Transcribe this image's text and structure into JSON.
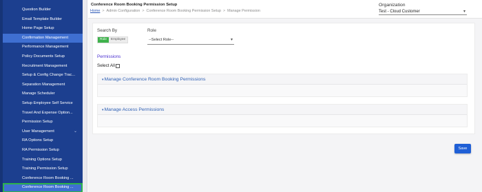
{
  "sidebar": {
    "items": [
      {
        "label": "Question Builder",
        "state": "normal"
      },
      {
        "label": "Email Template Builder",
        "state": "normal"
      },
      {
        "label": "Home Page Setup",
        "state": "normal"
      },
      {
        "label": "Confirmation Management",
        "state": "highlight"
      },
      {
        "label": "Performance Management",
        "state": "normal"
      },
      {
        "label": "Policy Documents Setup",
        "state": "normal"
      },
      {
        "label": "Recruitment Management",
        "state": "normal"
      },
      {
        "label": "Setup & Config Change Trac...",
        "state": "normal"
      },
      {
        "label": "Separation Management",
        "state": "normal"
      },
      {
        "label": "Manage Scheduler",
        "state": "normal"
      },
      {
        "label": "Setup Employee Self Service",
        "state": "normal"
      },
      {
        "label": "Travel And Expense Option...",
        "state": "normal"
      },
      {
        "label": "Permission Setup",
        "state": "normal"
      },
      {
        "label": "User Management",
        "state": "normal",
        "has_chevron": true
      },
      {
        "label": "RA Options Setup",
        "state": "normal"
      },
      {
        "label": "RA Permission Setup",
        "state": "normal"
      },
      {
        "label": "Training Options Setup",
        "state": "normal"
      },
      {
        "label": "Training Permission Setup",
        "state": "normal"
      },
      {
        "label": "Conference Room Booking ...",
        "state": "normal"
      },
      {
        "label": "Conference Room Booking ...",
        "state": "active"
      }
    ]
  },
  "header": {
    "title": "Conference Room Booking Permission Setup",
    "breadcrumb": {
      "home": "Home",
      "sep": ">",
      "items": [
        "Admin Configuration",
        "Conference Room Booking Permission Setup",
        "Manage Permission"
      ]
    },
    "organization": {
      "label": "Organization",
      "value": "Test - Cloud Customer",
      "caret": "▾"
    }
  },
  "form": {
    "search_by": {
      "label": "Search By",
      "options": [
        "Role",
        "Employee"
      ],
      "selected": "Role"
    },
    "role": {
      "label": "Role",
      "value": "--Select Role--",
      "caret": "▾"
    },
    "permissions_link": "Permissions",
    "select_all_label": "Select All",
    "sections": [
      {
        "title": "Manage Conference Room Booking Permissions",
        "marker": "▾"
      },
      {
        "title": "Manage Access Permissions",
        "marker": "▾"
      }
    ]
  },
  "actions": {
    "save_label": "Save"
  },
  "colors": {
    "sidebar_bg": "#1c3f8f",
    "sidebar_highlight": "#3f6fd1",
    "active_outline": "#2bb34a",
    "toggle_on": "#3fb24c",
    "link_purple": "#4a2fd0",
    "section_title": "#2d5fb4",
    "save_button": "#1f5fd6"
  }
}
